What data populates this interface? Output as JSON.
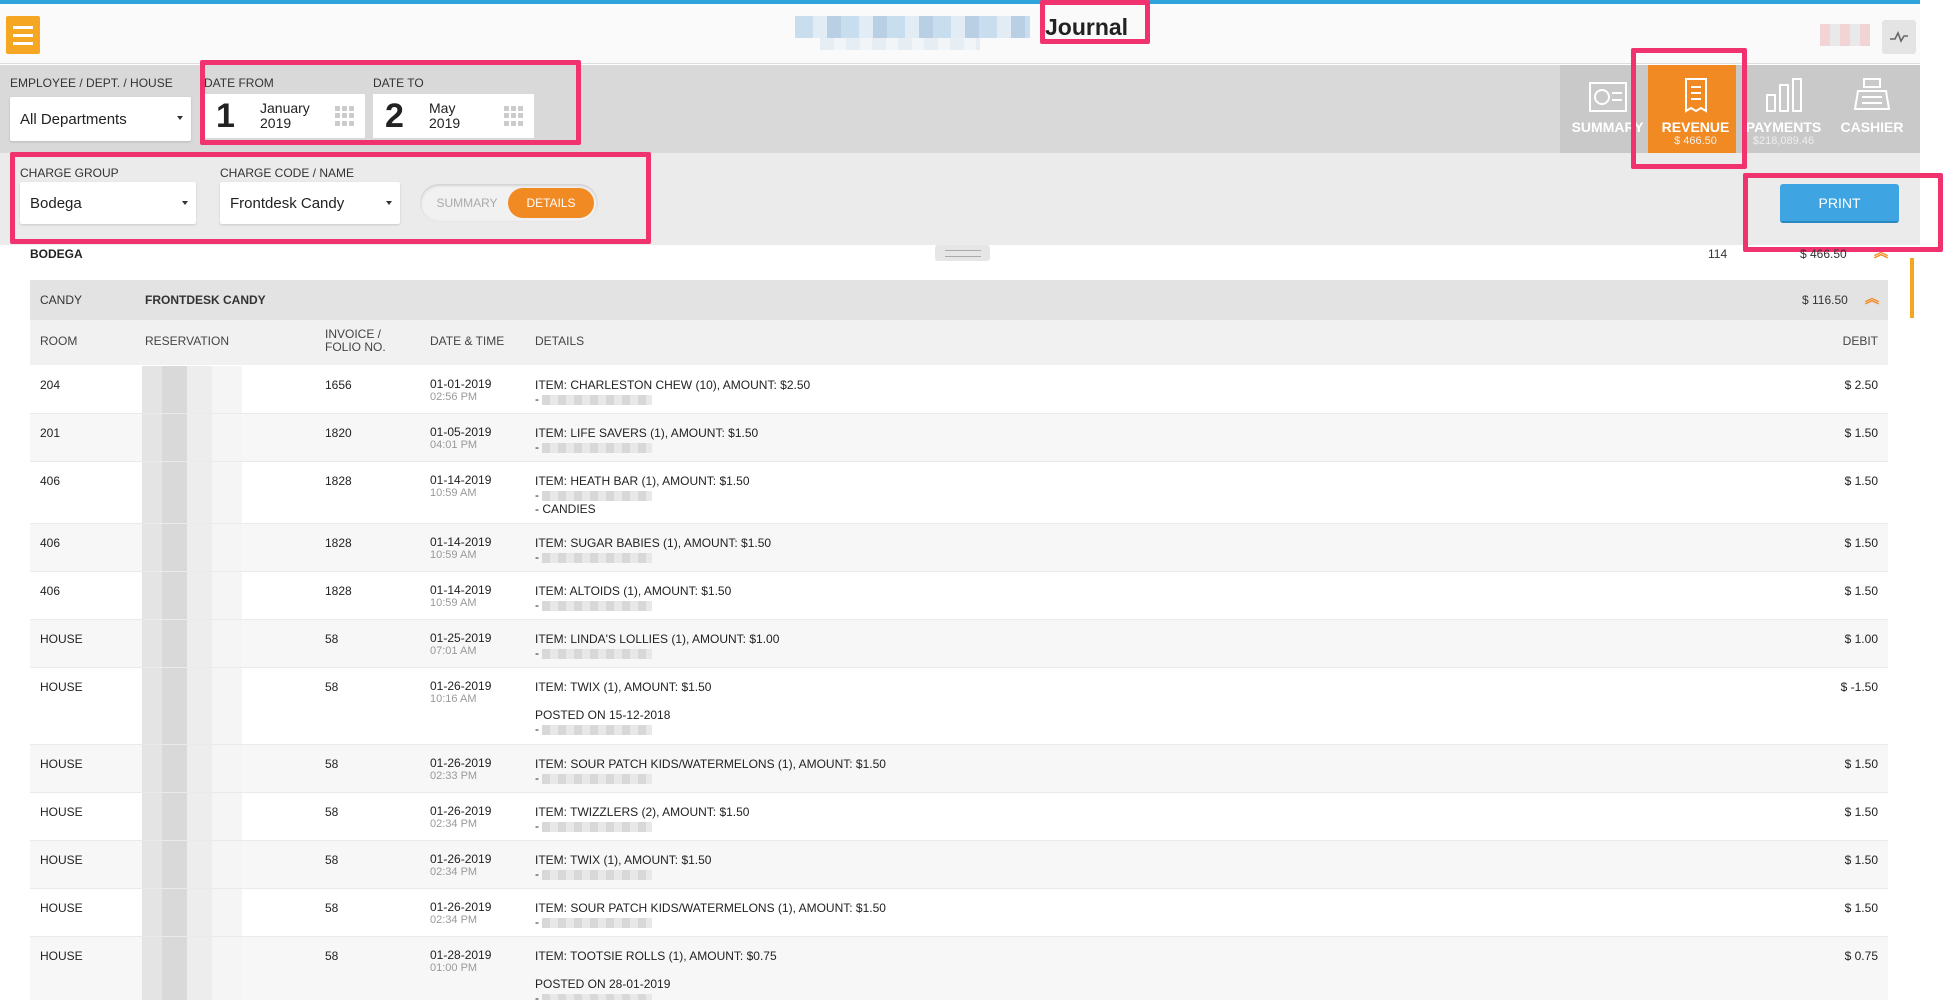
{
  "header": {
    "title": "Journal",
    "menu_icon": "hamburger-icon",
    "activity_icon": "activity-icon"
  },
  "filters": {
    "employee_label": "EMPLOYEE / DEPT. / HOUSE",
    "employee_value": "All Departments",
    "date_from_label": "DATE FROM",
    "date_from_day": "1",
    "date_from_month": "January",
    "date_from_year": "2019",
    "date_to_label": "DATE TO",
    "date_to_day": "2",
    "date_to_month": "May",
    "date_to_year": "2019",
    "charge_group_label": "CHARGE GROUP",
    "charge_group_value": "Bodega",
    "charge_code_label": "CHARGE CODE / NAME",
    "charge_code_value": "Frontdesk Candy",
    "toggle_summary": "SUMMARY",
    "toggle_details": "DETAILS",
    "print_label": "PRINT"
  },
  "tabs": [
    {
      "label": "SUMMARY",
      "value": "",
      "icon": "summary-icon"
    },
    {
      "label": "REVENUE",
      "value": "$ 466.50",
      "icon": "receipt-icon"
    },
    {
      "label": "PAYMENTS",
      "value": "$218,089.46",
      "icon": "bar-chart-icon"
    },
    {
      "label": "CASHIER",
      "value": "",
      "icon": "cash-register-icon"
    }
  ],
  "group": {
    "name": "BODEGA",
    "count": "114",
    "total": "$ 466.50"
  },
  "subgroup": {
    "code": "CANDY",
    "name": "FRONTDESK CANDY",
    "total": "$ 116.50"
  },
  "columns": {
    "room": "ROOM",
    "reservation": "RESERVATION",
    "invoice": "INVOICE / FOLIO NO.",
    "datetime": "DATE & TIME",
    "details": "DETAILS",
    "debit": "DEBIT"
  },
  "rows": [
    {
      "room": "204",
      "invoice": "1656",
      "date": "01-01-2019",
      "time": "02:56 PM",
      "item": "ITEM: CHARLESTON CHEW (10), AMOUNT: $2.50",
      "extra": "",
      "posted": "",
      "debit": "$ 2.50"
    },
    {
      "room": "201",
      "invoice": "1820",
      "date": "01-05-2019",
      "time": "04:01 PM",
      "item": "ITEM: LIFE SAVERS (1), AMOUNT: $1.50",
      "extra": "",
      "posted": "",
      "debit": "$ 1.50"
    },
    {
      "room": "406",
      "invoice": "1828",
      "date": "01-14-2019",
      "time": "10:59 AM",
      "item": "ITEM: HEATH BAR (1), AMOUNT: $1.50",
      "extra": "- CANDIES",
      "posted": "",
      "debit": "$ 1.50"
    },
    {
      "room": "406",
      "invoice": "1828",
      "date": "01-14-2019",
      "time": "10:59 AM",
      "item": "ITEM: SUGAR BABIES (1), AMOUNT: $1.50",
      "extra": "",
      "posted": "",
      "debit": "$ 1.50"
    },
    {
      "room": "406",
      "invoice": "1828",
      "date": "01-14-2019",
      "time": "10:59 AM",
      "item": "ITEM: ALTOIDS (1), AMOUNT: $1.50",
      "extra": "",
      "posted": "",
      "debit": "$ 1.50"
    },
    {
      "room": "HOUSE",
      "invoice": "58",
      "date": "01-25-2019",
      "time": "07:01 AM",
      "item": "ITEM: LINDA'S LOLLIES (1), AMOUNT: $1.00",
      "extra": "",
      "posted": "",
      "debit": "$ 1.00"
    },
    {
      "room": "HOUSE",
      "invoice": "58",
      "date": "01-26-2019",
      "time": "10:16 AM",
      "item": "ITEM: TWIX (1), AMOUNT: $1.50",
      "extra": "",
      "posted": "POSTED ON 15-12-2018",
      "debit": "$ -1.50"
    },
    {
      "room": "HOUSE",
      "invoice": "58",
      "date": "01-26-2019",
      "time": "02:33 PM",
      "item": "ITEM: SOUR PATCH KIDS/WATERMELONS (1), AMOUNT: $1.50",
      "extra": "",
      "posted": "",
      "debit": "$ 1.50"
    },
    {
      "room": "HOUSE",
      "invoice": "58",
      "date": "01-26-2019",
      "time": "02:34 PM",
      "item": "ITEM: TWIZZLERS (2), AMOUNT: $1.50",
      "extra": "",
      "posted": "",
      "debit": "$ 1.50"
    },
    {
      "room": "HOUSE",
      "invoice": "58",
      "date": "01-26-2019",
      "time": "02:34 PM",
      "item": "ITEM: TWIX (1), AMOUNT: $1.50",
      "extra": "",
      "posted": "",
      "debit": "$ 1.50"
    },
    {
      "room": "HOUSE",
      "invoice": "58",
      "date": "01-26-2019",
      "time": "02:34 PM",
      "item": "ITEM: SOUR PATCH KIDS/WATERMELONS (1), AMOUNT: $1.50",
      "extra": "",
      "posted": "",
      "debit": "$ 1.50"
    },
    {
      "room": "HOUSE",
      "invoice": "58",
      "date": "01-28-2019",
      "time": "01:00 PM",
      "item": "ITEM: TOOTSIE ROLLS (1), AMOUNT: $0.75",
      "extra": "",
      "posted": "POSTED ON 28-01-2019",
      "debit": "$ 0.75"
    }
  ],
  "colors": {
    "accent": "#f28a24",
    "print": "#3ea5e2",
    "highlight": "#f0336f",
    "menu": "#f5a623"
  }
}
